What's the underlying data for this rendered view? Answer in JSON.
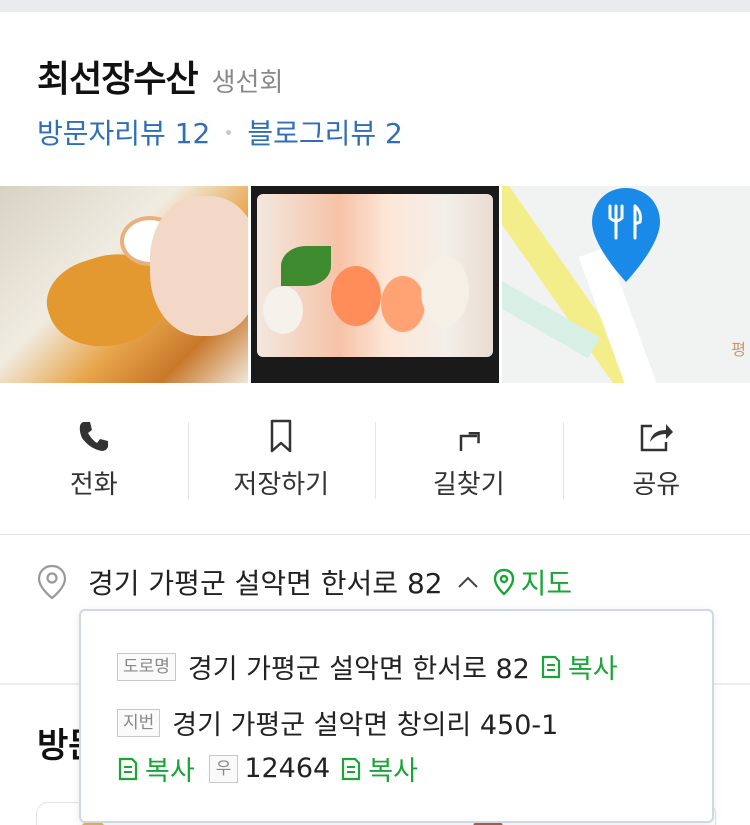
{
  "place": {
    "name": "최선장수산",
    "category": "생선회",
    "visitor_reviews": "방문자리뷰 12",
    "blog_reviews": "블로그리뷰 2"
  },
  "photos": [
    {
      "icon": "food-photo"
    },
    {
      "icon": "sushi-photo"
    },
    {
      "icon": "map-thumbnail",
      "map_label": "평"
    }
  ],
  "actions": [
    {
      "label": "전화",
      "icon": "phone-icon"
    },
    {
      "label": "저장하기",
      "icon": "bookmark-icon"
    },
    {
      "label": "길찾기",
      "icon": "directions-icon"
    },
    {
      "label": "공유",
      "icon": "share-icon"
    }
  ],
  "address": {
    "text": "경기 가평군 설악면 한서로 82",
    "map_label": "지도"
  },
  "address_popup": {
    "road_tag": "도로명",
    "road_address": "경기 가평군 설악면 한서로 82",
    "lot_tag": "지번",
    "lot_address": "경기 가평군 설악면 창의리 450-1",
    "zip_tag": "우",
    "zip_code": "12464",
    "copy_label": "복사"
  },
  "section": {
    "visit_title": "방문"
  },
  "colors": {
    "link_blue": "#2f6fb6",
    "naver_green": "#19a537",
    "map_pin_blue": "#1a8ae8"
  }
}
